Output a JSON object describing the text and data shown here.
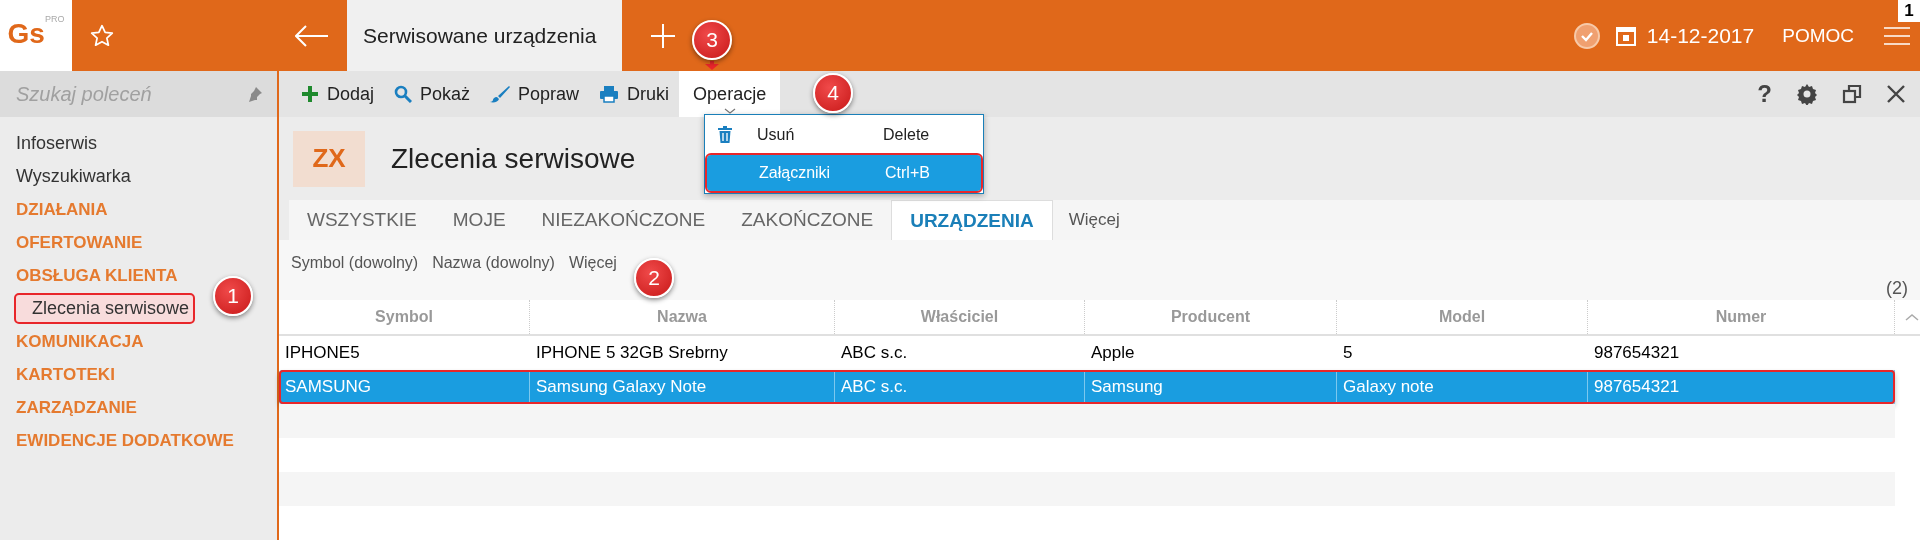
{
  "app": {
    "logo": "Gs",
    "logo_sup": "PRO",
    "tab": "Serwisowane urządzenia",
    "date": "14-12-2017",
    "help": "POMOC",
    "corner_badge": "1"
  },
  "sidebar": {
    "search": {
      "placeholder": "Szukaj poleceń"
    },
    "items": [
      {
        "label": "Infoserwis",
        "kind": "link",
        "highlighted": false
      },
      {
        "label": "Wyszukiwarka",
        "kind": "link",
        "highlighted": false
      },
      {
        "label": "DZIAŁANIA",
        "kind": "section",
        "highlighted": false
      },
      {
        "label": "OFERTOWANIE",
        "kind": "section",
        "highlighted": false
      },
      {
        "label": "OBSŁUGA KLIENTA",
        "kind": "section",
        "highlighted": false
      },
      {
        "label": "Zlecenia serwisowe",
        "kind": "subitem",
        "highlighted": true
      },
      {
        "label": "KOMUNIKACJA",
        "kind": "section",
        "highlighted": false
      },
      {
        "label": "KARTOTEKI",
        "kind": "section",
        "highlighted": false
      },
      {
        "label": "ZARZĄDZANIE",
        "kind": "section",
        "highlighted": false
      },
      {
        "label": "EWIDENCJE DODATKOWE",
        "kind": "section",
        "highlighted": false
      }
    ]
  },
  "toolbar": {
    "buttons": [
      {
        "label": "Dodaj",
        "kind": "add"
      },
      {
        "label": "Pokaż",
        "kind": "show"
      },
      {
        "label": "Popraw",
        "kind": "edit"
      },
      {
        "label": "Druki",
        "kind": "print"
      },
      {
        "label": "Operacje",
        "kind": "menu"
      }
    ],
    "help": "?"
  },
  "menu": {
    "items": [
      {
        "label": "Usuń",
        "shortcut": "Delete",
        "kind": "delete",
        "selected": false,
        "highlighted": false
      },
      {
        "label": "Załączniki",
        "shortcut": "Ctrl+B",
        "kind": "plain",
        "selected": true,
        "highlighted": true
      }
    ]
  },
  "header": {
    "badge": "ZX",
    "title": "Zlecenia serwisowe"
  },
  "tabs": [
    {
      "label": "WSZYSTKIE",
      "selected": false
    },
    {
      "label": "MOJE",
      "selected": false
    },
    {
      "label": "NIEZAKOŃCZONE",
      "selected": false
    },
    {
      "label": "ZAKOŃCZONE",
      "selected": false
    },
    {
      "label": "URZĄDZENIA",
      "selected": true
    }
  ],
  "tabs_more": "Więcej",
  "filters": [
    "Symbol (dowolny)",
    "Nazwa (dowolny)",
    "Więcej"
  ],
  "count": "(2)",
  "table": {
    "columns": [
      "Symbol",
      "Nazwa",
      "Właściciel",
      "Producent",
      "Model",
      "Numer"
    ],
    "rows": [
      {
        "cells": [
          "IPHONE5",
          "IPHONE 5 32GB Srebrny",
          "ABC s.c.",
          "Apple",
          "5",
          "987654321"
        ],
        "selected": false,
        "highlighted": false
      },
      {
        "cells": [
          "SAMSUNG",
          "Samsung Galaxy Note",
          "ABC s.c.",
          "Samsung",
          "Galaxy note",
          "987654321"
        ],
        "selected": true,
        "highlighted": true
      }
    ]
  },
  "callouts": [
    {
      "number": "1"
    },
    {
      "number": "2"
    },
    {
      "number": "3"
    },
    {
      "number": "4"
    }
  ]
}
